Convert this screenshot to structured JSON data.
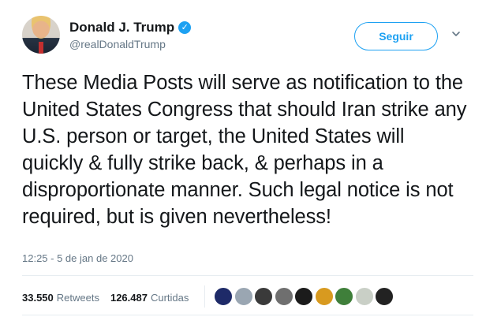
{
  "author": {
    "name": "Donald J. Trump",
    "handle": "@realDonaldTrump",
    "verified_icon": "verified-badge-icon",
    "follow_label": "Seguir",
    "more_icon": "chevron-down-icon"
  },
  "tweet": {
    "text": "These Media Posts will serve as notification to the United States Congress that should Iran strike any U.S. person or target, the United States will quickly & fully strike back, & perhaps in a disproportionate manner. Such legal notice is not required, but is given nevertheless!",
    "timestamp": "12:25 - 5 de jan de 2020"
  },
  "stats": {
    "retweets_count": "33.550",
    "retweets_label": "Retweets",
    "likes_count": "126.487",
    "likes_label": "Curtidas"
  },
  "liked_by": {
    "avatars": [
      {
        "color": "#1e2a68"
      },
      {
        "color": "#9aa6b2"
      },
      {
        "color": "#3a3a3a"
      },
      {
        "color": "#6f6f6f"
      },
      {
        "color": "#1b1b1b"
      },
      {
        "color": "#d89a1f"
      },
      {
        "color": "#3f7f3a"
      },
      {
        "color": "#c9cfc6"
      },
      {
        "color": "#222222"
      }
    ]
  },
  "colors": {
    "accent": "#1da1f2",
    "text": "#14171a",
    "muted": "#657786",
    "border": "#e6ecf0"
  }
}
